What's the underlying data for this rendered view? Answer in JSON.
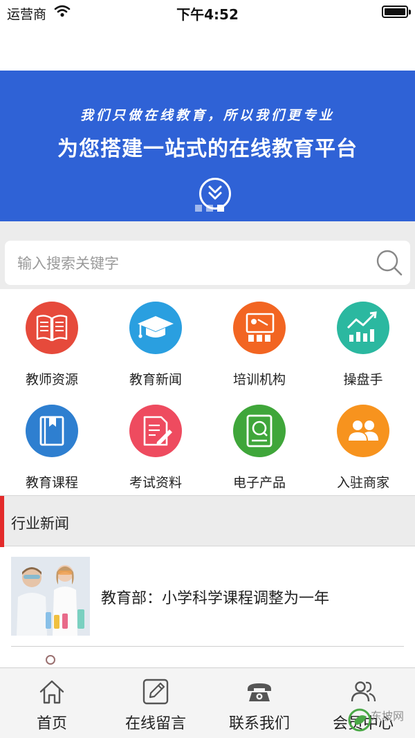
{
  "status_bar": {
    "carrier": "运营商",
    "time": "下午4:52",
    "battery_level": 1.0
  },
  "banner": {
    "subtitle": "我们只做在线教育，所以我们更专业",
    "title": "为您搭建一站式的在线教育平台",
    "background_color": "#2f62d6",
    "slide_count": 3,
    "active_slide": 3
  },
  "search": {
    "placeholder": "输入搜索关键字"
  },
  "categories": [
    {
      "label": "教师资源",
      "icon": "open-book-icon",
      "color": "#e64a3b"
    },
    {
      "label": "教育新闻",
      "icon": "graduation-cap-icon",
      "color": "#2a9fe0"
    },
    {
      "label": "培训机构",
      "icon": "classroom-icon",
      "color": "#f26522"
    },
    {
      "label": "操盘手",
      "icon": "trend-chart-icon",
      "color": "#2bb8a0"
    },
    {
      "label": "教育课程",
      "icon": "course-book-icon",
      "color": "#2e7fd0"
    },
    {
      "label": "考试资料",
      "icon": "exam-paper-icon",
      "color": "#ee4b5f"
    },
    {
      "label": "电子产品",
      "icon": "hard-drive-icon",
      "color": "#3fa63a"
    },
    {
      "label": "入驻商家",
      "icon": "merchants-icon",
      "color": "#f7931e"
    }
  ],
  "section": {
    "title": "行业新闻",
    "accent_color": "#e32b2b"
  },
  "news": [
    {
      "title": "教育部：小学科学课程调整为一年"
    }
  ],
  "tabbar": {
    "tabs": [
      {
        "label": "首页",
        "icon": "home-icon"
      },
      {
        "label": "在线留言",
        "icon": "edit-message-icon"
      },
      {
        "label": "联系我们",
        "icon": "telephone-icon"
      },
      {
        "label": "会员中心",
        "icon": "members-icon"
      }
    ]
  },
  "watermark": {
    "text": "东坡网"
  }
}
